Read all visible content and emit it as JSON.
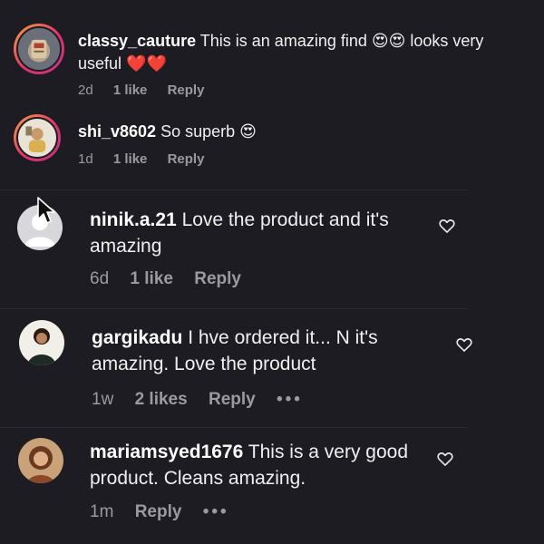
{
  "comments": [
    {
      "username": "classy_cauture",
      "text": "This is an amazing find 😍😍 looks very useful ❤️❤️",
      "time": "2d",
      "likes": "1 like",
      "reply": "Reply"
    },
    {
      "username": "shi_v8602",
      "text": "So superb 😍",
      "time": "1d",
      "likes": "1 like",
      "reply": "Reply"
    },
    {
      "username": "ninik.a.21",
      "text": "Love the product and it's amazing",
      "time": "6d",
      "likes": "1 like",
      "reply": "Reply"
    },
    {
      "username": "gargikadu",
      "text": "I hve ordered it... N it's amazing. Love the product",
      "time": "1w",
      "likes": "2 likes",
      "reply": "Reply",
      "more": "•••"
    },
    {
      "username": "mariamsyed1676",
      "text": "This is a very good product. Cleans amazing.",
      "time": "1m",
      "reply": "Reply",
      "more": "•••"
    }
  ],
  "colors": {
    "background": "#1c1c22",
    "meta": "#9a9aa2",
    "text": "#f0f0f0",
    "story_ring_start": "#f9a23c",
    "story_ring_end": "#c13584"
  },
  "icons": {
    "like": "heart-outline-icon",
    "more": "more-options-icon",
    "pointer": "mouse-pointer-icon"
  }
}
